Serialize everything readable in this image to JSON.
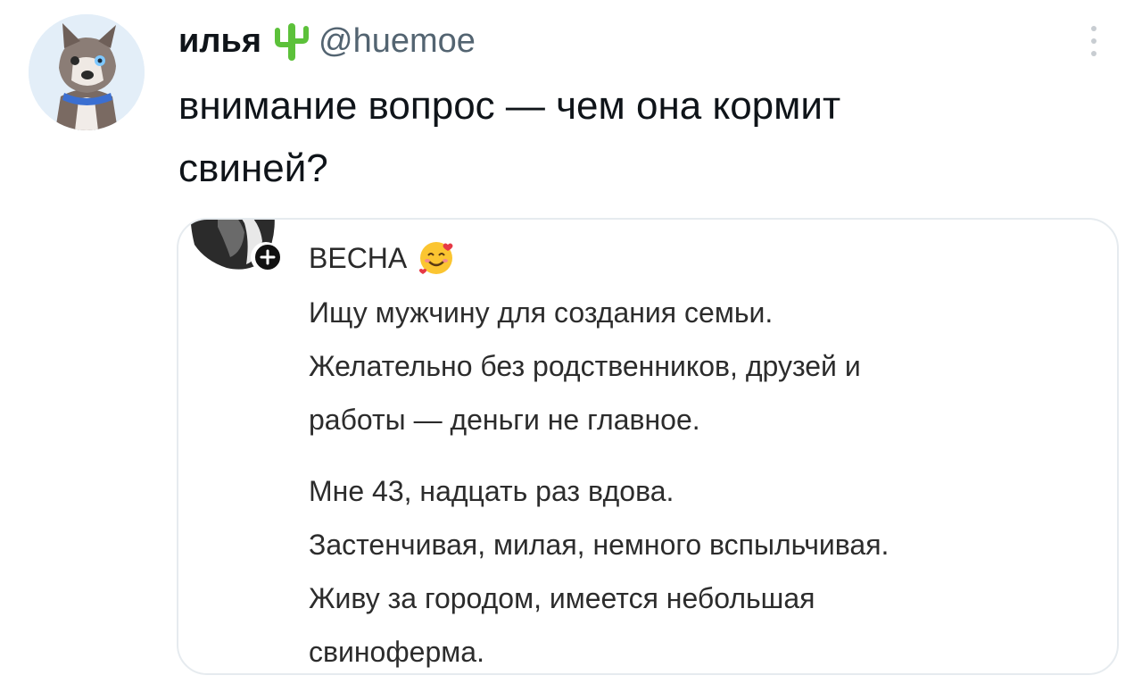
{
  "tweet": {
    "author": {
      "display_name": "илья",
      "handle": "@huemoe",
      "name_emoji": "cactus-icon",
      "avatar": "husky-dog-avatar"
    },
    "text_lines": [
      "внимание вопрос — чем она кормит",
      "свиней?"
    ],
    "menu_icon": "more-vertical-icon"
  },
  "quote": {
    "author_name": "ВЕСНА",
    "name_emoji": "smiling-face-with-hearts-icon",
    "avatar": "woman-profile-avatar",
    "follow_icon": "plus-badge-icon",
    "paragraph1": [
      "Ищу мужчину для создания семьи.",
      "Желательно без родственников, друзей и",
      "работы — деньги не главное."
    ],
    "paragraph2": [
      "Мне 43, надцать раз вдова.",
      "Застенчивая, милая, немного вспыльчивая.",
      "Живу за городом, имеется небольшая",
      "свиноферма."
    ]
  },
  "colors": {
    "text": "#0f1419",
    "handle": "#536471",
    "card_border": "#e6ebef",
    "cactus": "#5cc13a",
    "avatar_bg": "#e3eef8"
  }
}
